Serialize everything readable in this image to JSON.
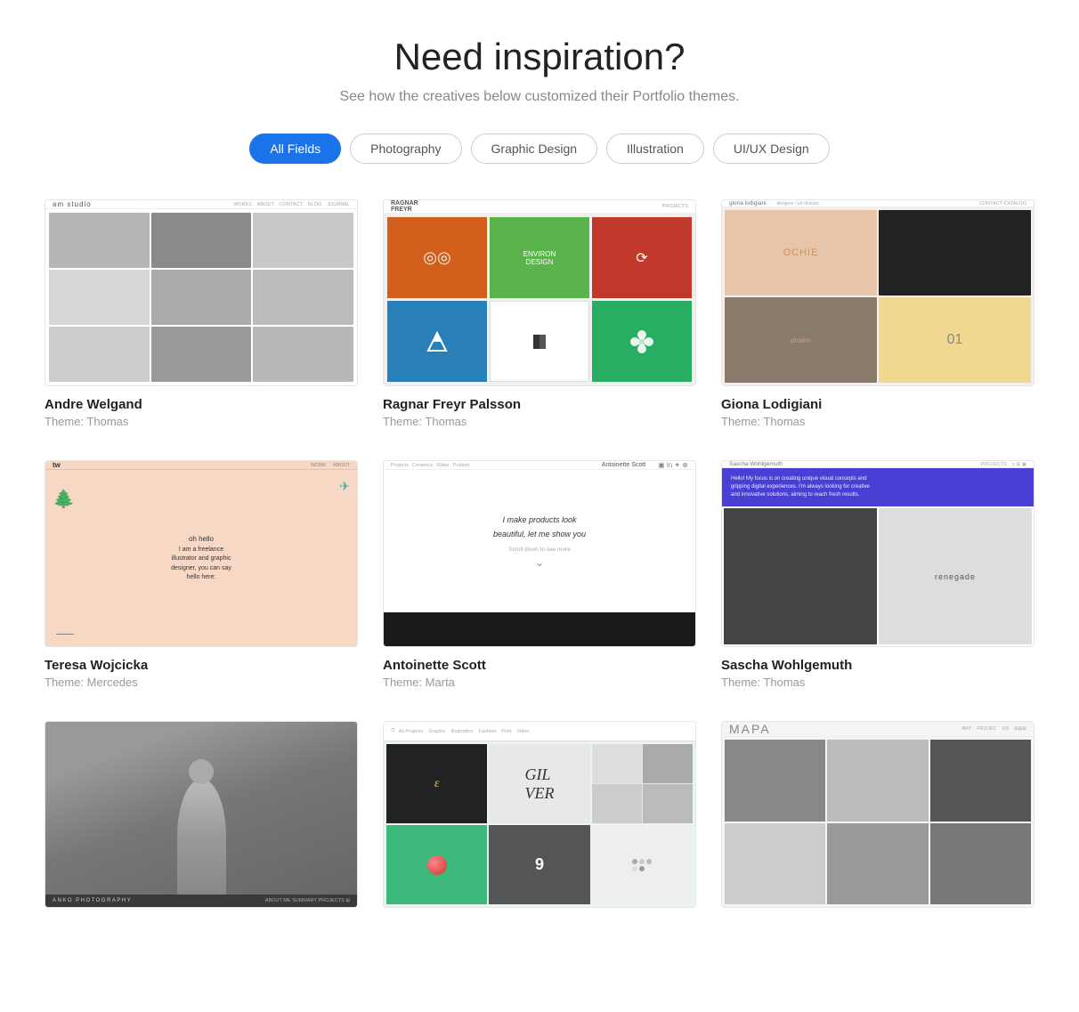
{
  "header": {
    "title": "Need inspiration?",
    "subtitle": "See how the creatives below customized their Portfolio themes."
  },
  "filters": {
    "tabs": [
      {
        "label": "All Fields",
        "active": true
      },
      {
        "label": "Photography",
        "active": false
      },
      {
        "label": "Graphic Design",
        "active": false
      },
      {
        "label": "Illustration",
        "active": false
      },
      {
        "label": "UI/UX Design",
        "active": false
      }
    ]
  },
  "portfolios": [
    {
      "name": "Andre Welgand",
      "theme": "Theme: Thomas",
      "type": "am-studio"
    },
    {
      "name": "Ragnar Freyr Palsson",
      "theme": "Theme: Thomas",
      "type": "ragnar"
    },
    {
      "name": "Giona Lodigiani",
      "theme": "Theme: Thomas",
      "type": "giona"
    },
    {
      "name": "Teresa Wojcicka",
      "theme": "Theme: Mercedes",
      "type": "teresa"
    },
    {
      "name": "Antoinette Scott",
      "theme": "Theme: Marta",
      "type": "antoinette"
    },
    {
      "name": "Sascha Wohlgemuth",
      "theme": "Theme: Thomas",
      "type": "sascha"
    },
    {
      "name": "",
      "theme": "",
      "type": "anko"
    },
    {
      "name": "",
      "theme": "",
      "type": "emporia"
    },
    {
      "name": "",
      "theme": "",
      "type": "mapa"
    }
  ],
  "labels": {
    "theme_prefix": "Theme:"
  }
}
